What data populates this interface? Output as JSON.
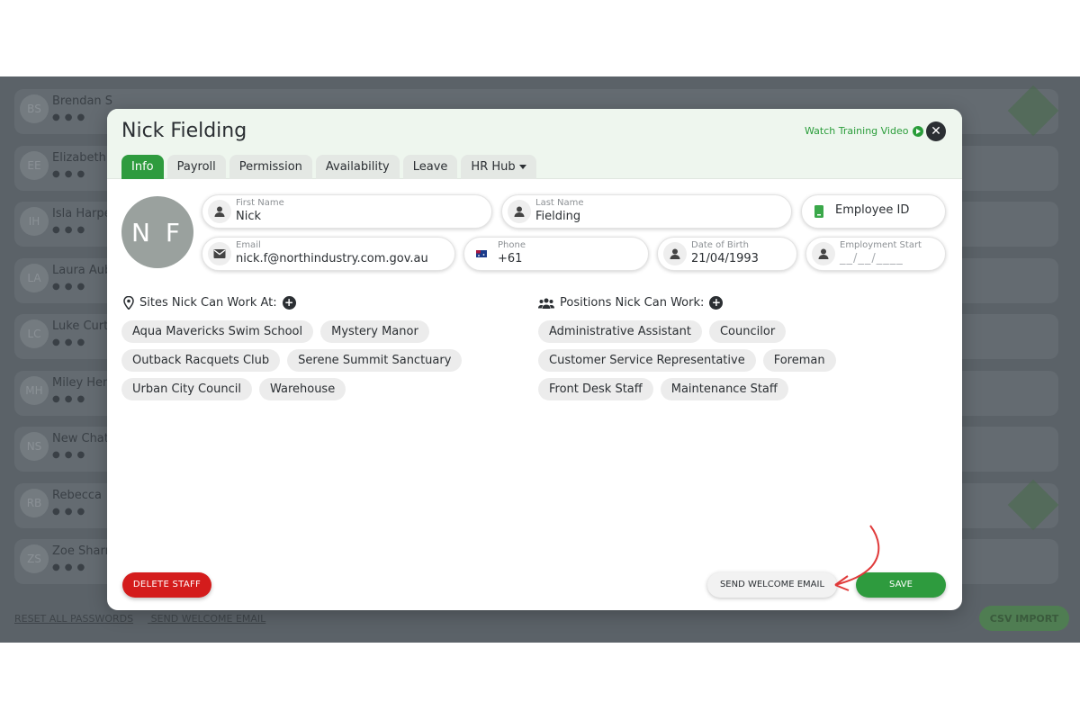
{
  "background": {
    "rows": [
      {
        "initials": "BS",
        "name": "Brendan S"
      },
      {
        "initials": "EE",
        "name": "Elizabeth"
      },
      {
        "initials": "IH",
        "name": "Isla Harpe"
      },
      {
        "initials": "LA",
        "name": "Laura Aub"
      },
      {
        "initials": "LC",
        "name": "Luke Curti"
      },
      {
        "initials": "MH",
        "name": "Miley Hen"
      },
      {
        "initials": "NS",
        "name": "New Chat"
      },
      {
        "initials": "RB",
        "name": "Rebecca"
      },
      {
        "initials": "ZS",
        "name": "Zoe Sharr"
      }
    ],
    "reset_link": "RESET ALL PASSWORDS",
    "welcome_link": "SEND WELCOME EMAIL",
    "csv_import": "CSV IMPORT"
  },
  "modal": {
    "title": "Nick Fielding",
    "watch_training": "Watch Training Video",
    "close_icon": "close-icon",
    "tabs": [
      "Info",
      "Payroll",
      "Permission",
      "Availability",
      "Leave",
      "HR Hub"
    ],
    "active_tab": "Info",
    "avatar_initials": "N F",
    "fields": {
      "first_name": {
        "label": "First Name",
        "value": "Nick"
      },
      "last_name": {
        "label": "Last Name",
        "value": "Fielding"
      },
      "employee_id": {
        "label": "Employee ID"
      },
      "email": {
        "label": "Email",
        "value": "nick.f@northindustry.com.gov.au"
      },
      "phone": {
        "label": "Phone",
        "value": "+61"
      },
      "dob": {
        "label": "Date of Birth",
        "value": "21/04/1993"
      },
      "employment_start": {
        "label": "Employment Start",
        "placeholder": "__/__/____"
      }
    },
    "sites": {
      "title": "Sites Nick Can Work At:",
      "items": [
        "Aqua Mavericks Swim School",
        "Mystery Manor",
        "Outback Racquets Club",
        "Serene Summit Sanctuary",
        "Urban City Council",
        "Warehouse"
      ]
    },
    "positions": {
      "title": "Positions Nick Can Work:",
      "items": [
        "Administrative Assistant",
        "Councilor",
        "Customer Service Representative",
        "Foreman",
        "Front Desk Staff",
        "Maintenance Staff"
      ]
    },
    "buttons": {
      "delete": "DELETE STAFF",
      "welcome": "SEND WELCOME EMAIL",
      "save": "SAVE"
    }
  },
  "colors": {
    "accent_green": "#2e9b3e",
    "danger_red": "#d41c1c",
    "annotation_arrow": "#e03a3a"
  }
}
